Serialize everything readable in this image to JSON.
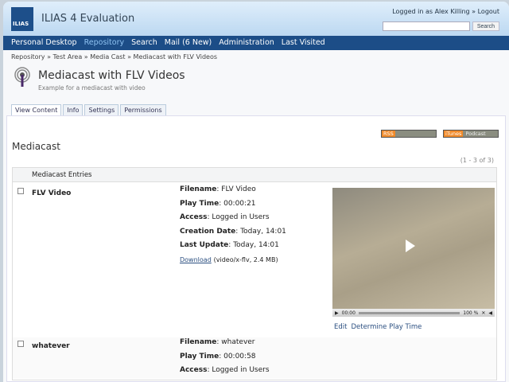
{
  "header": {
    "logo": "ILIAS",
    "title": "ILIAS 4 Evaluation",
    "login_text": "Logged in as Alex Killing",
    "logout": "Logout",
    "search_button": "Search"
  },
  "nav": [
    "Personal Desktop",
    "Repository",
    "Search",
    "Mail (6 New)",
    "Administration",
    "Last Visited"
  ],
  "breadcrumb": "Repository » Test Area » Media Cast » Mediacast with FLV Videos",
  "page": {
    "title": "Mediacast with FLV Videos",
    "description": "Example for a mediacast with video"
  },
  "tabs": [
    "View Content",
    "Info",
    "Settings",
    "Permissions"
  ],
  "section_title": "Mediacast",
  "badges": {
    "rss": "RSS",
    "itunes": "iTunes",
    "podcast": "Podcast"
  },
  "count": "(1 - 3 of 3)",
  "table_header": "Mediacast Entries",
  "labels": {
    "filename": "Filename",
    "play_time": "Play Time",
    "access": "Access",
    "creation": "Creation Date",
    "update": "Last Update"
  },
  "entries": [
    {
      "name": "FLV Video",
      "filename": "FLV Video",
      "play_time": "00:00:21",
      "access": "Logged in Users",
      "creation": "Today, 14:01",
      "update": "Today, 14:01",
      "download": "Download",
      "download_info": "(video/x-flv, 2.4 MB)",
      "time": "00:00",
      "zoom": "100 %",
      "edit": "Edit",
      "determine": "Determine Play Time"
    },
    {
      "name": "whatever",
      "filename": "whatever",
      "play_time": "00:00:58",
      "access": "Logged in Users"
    }
  ]
}
